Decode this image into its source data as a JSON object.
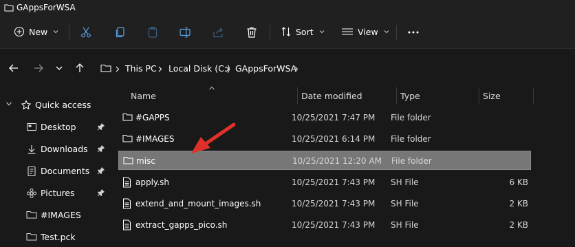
{
  "window": {
    "title": "GAppsForWSA"
  },
  "toolbar": {
    "new_label": "New",
    "sort_label": "Sort",
    "view_label": "View"
  },
  "breadcrumb": [
    "This PC",
    "Local Disk (C:)",
    "GAppsForWSA"
  ],
  "nav": {
    "quick_access": "Quick access",
    "items": [
      {
        "label": "Desktop",
        "icon": "desktop-icon",
        "pinned": true
      },
      {
        "label": "Downloads",
        "icon": "download-icon",
        "pinned": true
      },
      {
        "label": "Documents",
        "icon": "document-icon",
        "pinned": true
      },
      {
        "label": "Pictures",
        "icon": "pictures-icon",
        "pinned": true
      },
      {
        "label": "#IMAGES",
        "icon": "folder-icon",
        "pinned": false
      },
      {
        "label": "Test.pck",
        "icon": "folder-icon",
        "pinned": false
      }
    ]
  },
  "columns": {
    "name": "Name",
    "date": "Date modified",
    "type": "Type",
    "size": "Size"
  },
  "files": [
    {
      "name": "#GAPPS",
      "date": "10/25/2021 7:47 PM",
      "type": "File folder",
      "size": "",
      "icon": "folder-icon"
    },
    {
      "name": "#IMAGES",
      "date": "10/25/2021 6:14 PM",
      "type": "File folder",
      "size": "",
      "icon": "folder-icon"
    },
    {
      "name": "misc",
      "date": "10/25/2021 12:20 AM",
      "type": "File folder",
      "size": "",
      "icon": "folder-icon",
      "selected": true
    },
    {
      "name": "apply.sh",
      "date": "10/25/2021 7:43 PM",
      "type": "SH File",
      "size": "6 KB",
      "icon": "file-icon"
    },
    {
      "name": "extend_and_mount_images.sh",
      "date": "10/25/2021 7:43 PM",
      "type": "SH File",
      "size": "2 KB",
      "icon": "file-icon"
    },
    {
      "name": "extract_gapps_pico.sh",
      "date": "10/25/2021 7:43 PM",
      "type": "SH File",
      "size": "2 KB",
      "icon": "file-icon"
    }
  ],
  "colors": {
    "background": "#191919",
    "selection": "#777777",
    "annotation_arrow": "#e0302a"
  }
}
